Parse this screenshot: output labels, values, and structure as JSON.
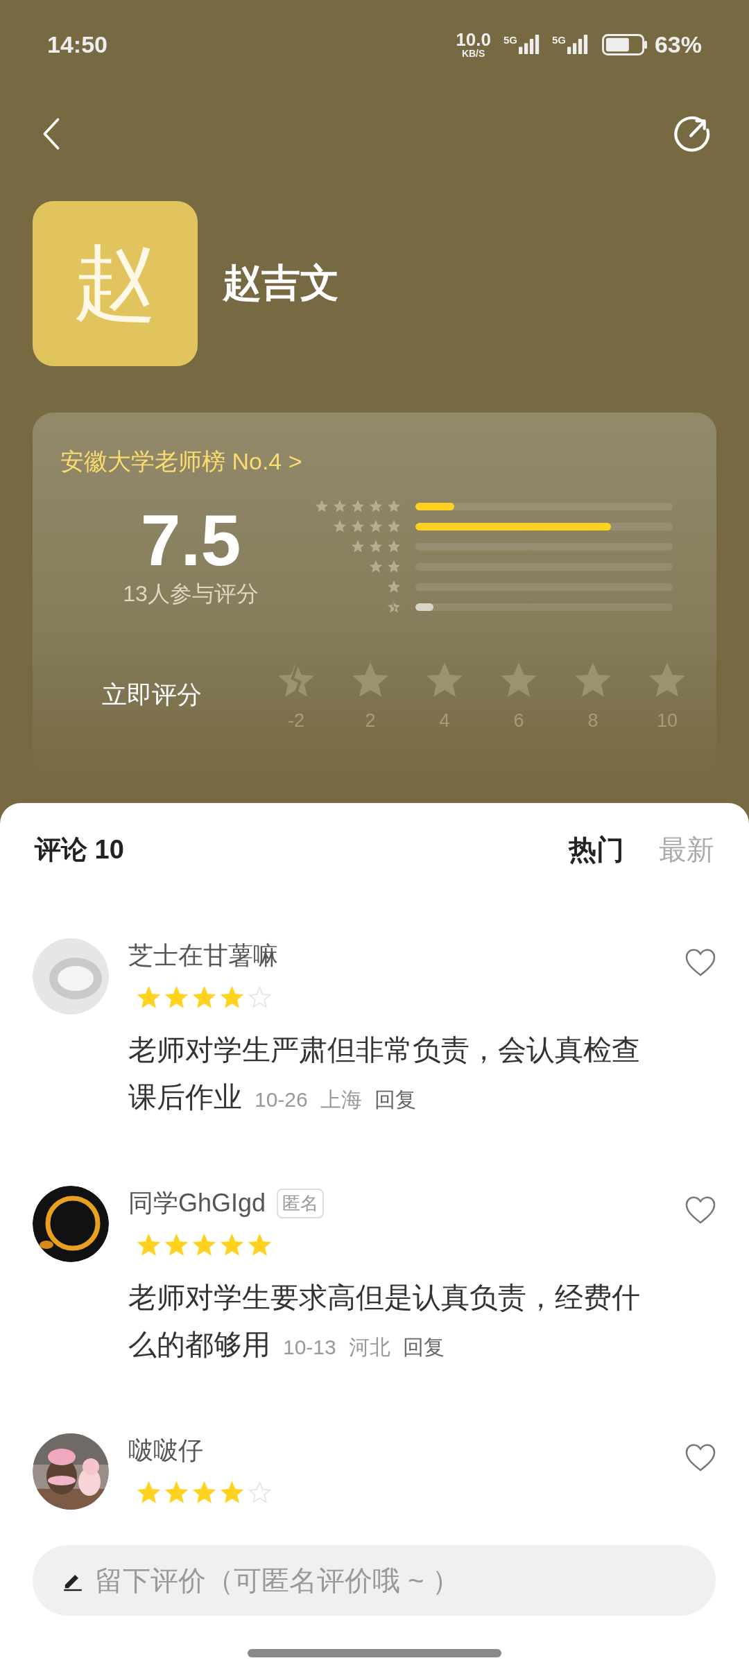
{
  "status_bar": {
    "time": "14:50",
    "speed": "10.0",
    "speed_unit": "KB/S",
    "networks": [
      "5G",
      "5G"
    ],
    "battery": "63%"
  },
  "teacher": {
    "initial": "赵",
    "name": "赵吉文"
  },
  "rating": {
    "rank": "安徽大学老师榜 No.4",
    "rank_arrow": ">",
    "score": "7.5",
    "participants": "13人参与评分",
    "distribution": [
      {
        "kind": "stars",
        "level": 0.15
      },
      {
        "kind": "stars",
        "level": 0.76
      },
      {
        "kind": "stars"
      },
      {
        "kind": "stars"
      },
      {
        "kind": "stars"
      },
      {
        "kind": "broken",
        "level": 0.07
      }
    ],
    "rate_label": "立即评分",
    "rate_options": [
      {
        "kind": "broken",
        "label": "-2"
      },
      {
        "kind": "star",
        "label": "2"
      },
      {
        "kind": "star",
        "label": "4"
      },
      {
        "kind": "star",
        "label": "6"
      },
      {
        "kind": "star",
        "label": "8"
      },
      {
        "kind": "star",
        "label": "10"
      }
    ]
  },
  "comments_header": {
    "title": "评论 10",
    "tabs": [
      {
        "label": "热门",
        "selected": true
      },
      {
        "label": "最新",
        "selected": false
      }
    ]
  },
  "comments": [
    {
      "avatar": {
        "kind": "grey"
      },
      "name": "芝士在甘薯嘛",
      "stars": 4,
      "text": "老师对学生严肃但非常负责，会认真检查课后作业",
      "date": "10-26",
      "location": "上海",
      "reply": "回复"
    },
    {
      "avatar": {
        "kind": "dark"
      },
      "name": "同学GhGIgd",
      "badge": "匿名",
      "stars": 5,
      "text": "老师对学生要求高但是认真负责，经费什么的都够用",
      "date": "10-13",
      "location": "河北",
      "reply": "回复"
    },
    {
      "name": "啵啵仔",
      "stars": 4
    }
  ],
  "input": {
    "placeholder": "留下评价（可匿名评价哦 ~ ）"
  }
}
